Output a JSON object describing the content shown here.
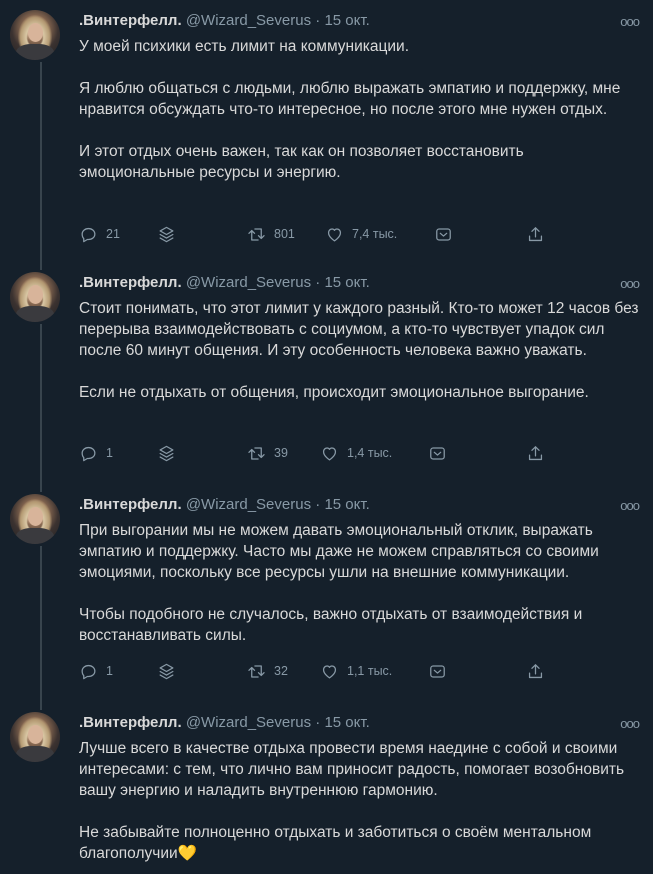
{
  "tweets": [
    {
      "name": ".Винтерфелл.",
      "handle": "@Wizard_Severus",
      "date": "15 окт.",
      "paragraphs": [
        "У моей психики есть лимит на коммуникации.",
        "Я люблю общаться с людьми, люблю выражать эмпатию и поддержку, мне нравится обсуждать что-то интересное, но после этого мне нужен отдых.",
        "И этот отдых очень важен, так как он позволяет восстановить эмоциональные ресурсы и энергию."
      ],
      "replies": "21",
      "retweets": "801",
      "likes": "7,4 тыс."
    },
    {
      "name": ".Винтерфелл.",
      "handle": "@Wizard_Severus",
      "date": "15 окт.",
      "paragraphs": [
        "Стоит понимать, что этот лимит у каждого разный. Кто-то может 12 часов без перерыва взаимодействовать с социумом, а кто-то чувствует упадок сил после 60 минут общения. И эту особенность человека важно уважать.",
        "Если не отдыхать от общения, происходит эмоциональное выгорание."
      ],
      "replies": "1",
      "retweets": "39",
      "likes": "1,4 тыс."
    },
    {
      "name": ".Винтерфелл.",
      "handle": "@Wizard_Severus",
      "date": "15 окт.",
      "paragraphs": [
        "При выгорании мы не можем давать эмоциональный отклик, выражать эмпатию и поддержку. Часто мы даже не можем справляться со своими эмоциями, поскольку все ресурсы ушли на внешние коммуникации.",
        "Чтобы подобного не случалось, важно отдыхать от взаимодействия и восстанавливать силы."
      ],
      "replies": "1",
      "retweets": "32",
      "likes": "1,1 тыс."
    },
    {
      "name": ".Винтерфелл.",
      "handle": "@Wizard_Severus",
      "date": "15 окт.",
      "paragraphs": [
        "Лучше всего в качестве отдыха провести время наедине с собой и своими интересами: с тем, что лично вам приносит радость, помогает возобновить вашу энергию и наладить внутреннюю гармонию.",
        "Не забывайте полноценно отдыхать и заботиться о своём ментальном благополучии"
      ],
      "emoji": "💛"
    }
  ],
  "ui": {
    "separator": "·",
    "more": "ooo",
    "icons": [
      "reply-icon",
      "layers-icon",
      "retweet-icon",
      "like-icon",
      "bookmark-icon",
      "share-icon"
    ]
  },
  "colors": {
    "background": "#15202b",
    "text": "#d9d9d9",
    "muted": "#8899a6",
    "thread_line": "#38444d"
  }
}
